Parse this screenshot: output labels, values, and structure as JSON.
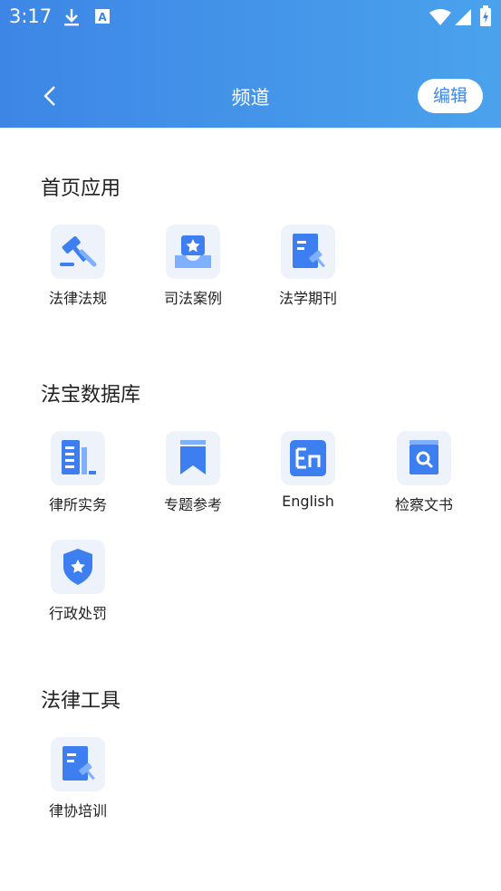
{
  "status_bar": {
    "time": "3:17"
  },
  "nav": {
    "title": "频道",
    "edit_label": "编辑"
  },
  "sections": [
    {
      "title": "首页应用",
      "items": [
        {
          "label": "法律法规",
          "icon": "gavel-icon"
        },
        {
          "label": "司法案例",
          "icon": "case-tray-icon"
        },
        {
          "label": "法学期刊",
          "icon": "journal-icon"
        }
      ]
    },
    {
      "title": "法宝数据库",
      "items": [
        {
          "label": "律所实务",
          "icon": "building-icon"
        },
        {
          "label": "专题参考",
          "icon": "bookmark-icon"
        },
        {
          "label": "English",
          "icon": "english-icon"
        },
        {
          "label": "检察文书",
          "icon": "search-book-icon"
        },
        {
          "label": "行政处罚",
          "icon": "shield-star-icon"
        }
      ]
    },
    {
      "title": "法律工具",
      "items": [
        {
          "label": "律协培训",
          "icon": "training-icon"
        }
      ]
    }
  ],
  "colors": {
    "header_start": "#3d86e6",
    "header_end": "#4aa2ec",
    "icon_blue": "#3d7ff0",
    "icon_bg": "#eef3fb"
  }
}
